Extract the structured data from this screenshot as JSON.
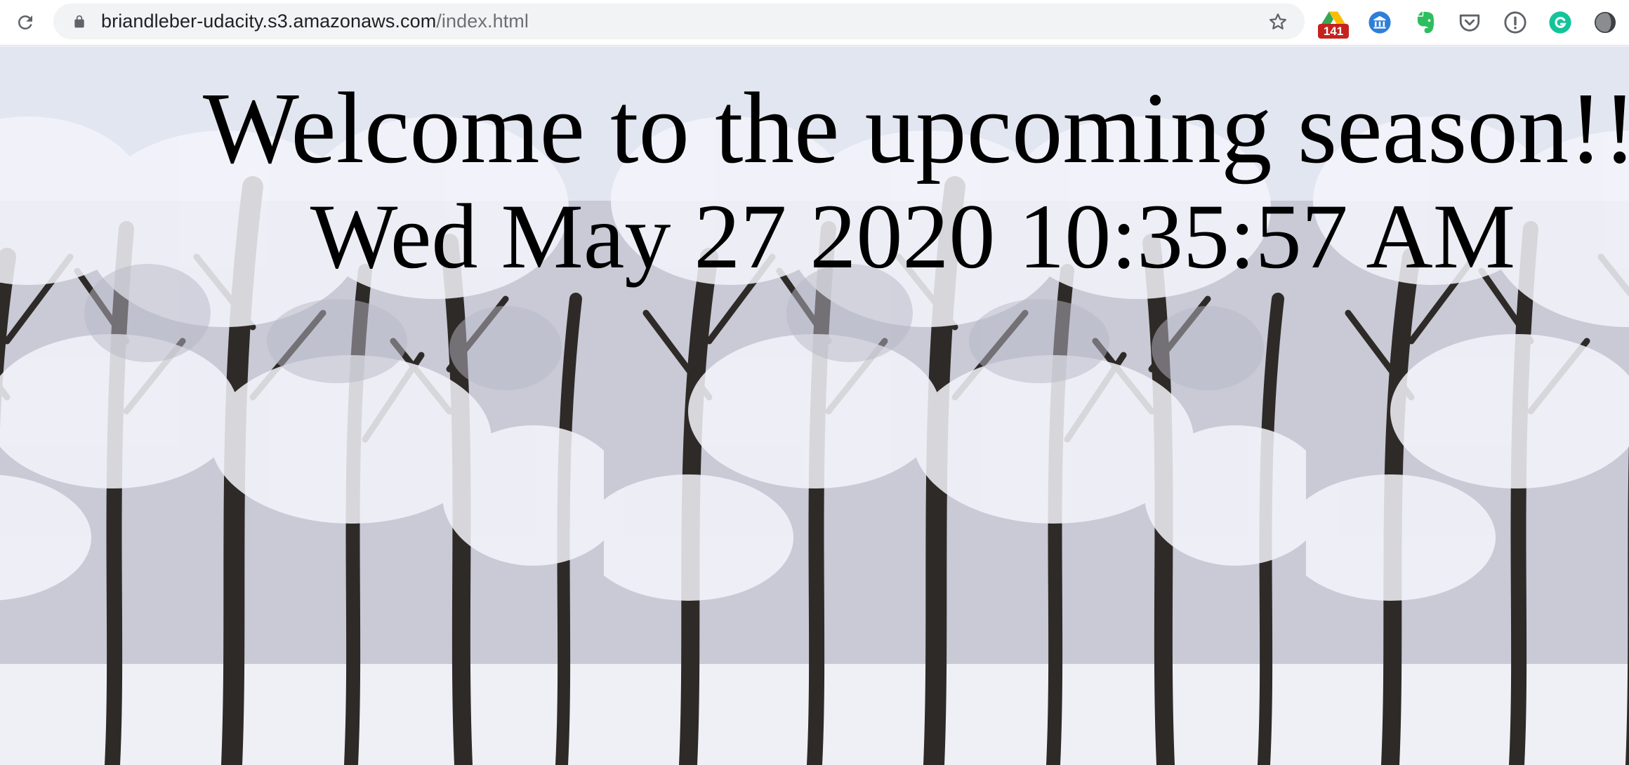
{
  "browser": {
    "url_host": "briandleber-udacity.s3.amazonaws.com",
    "url_path": "/index.html",
    "extensions": [
      {
        "name": "google-drive-icon",
        "badge": "141"
      },
      {
        "name": "bank-icon"
      },
      {
        "name": "evernote-icon"
      },
      {
        "name": "pocket-icon"
      },
      {
        "name": "password-manager-icon"
      },
      {
        "name": "grammarly-icon"
      },
      {
        "name": "dark-mode-icon"
      }
    ],
    "colors": {
      "toolbar_bg": "#ffffff",
      "omnibox_bg": "#f1f3f4",
      "badge_bg": "#c5221f"
    }
  },
  "page": {
    "heading": "Welcome to the upcoming season!!",
    "datetime": "Wed May 27 2020 10:35:57 AM",
    "background": "snowy-forest-image"
  }
}
